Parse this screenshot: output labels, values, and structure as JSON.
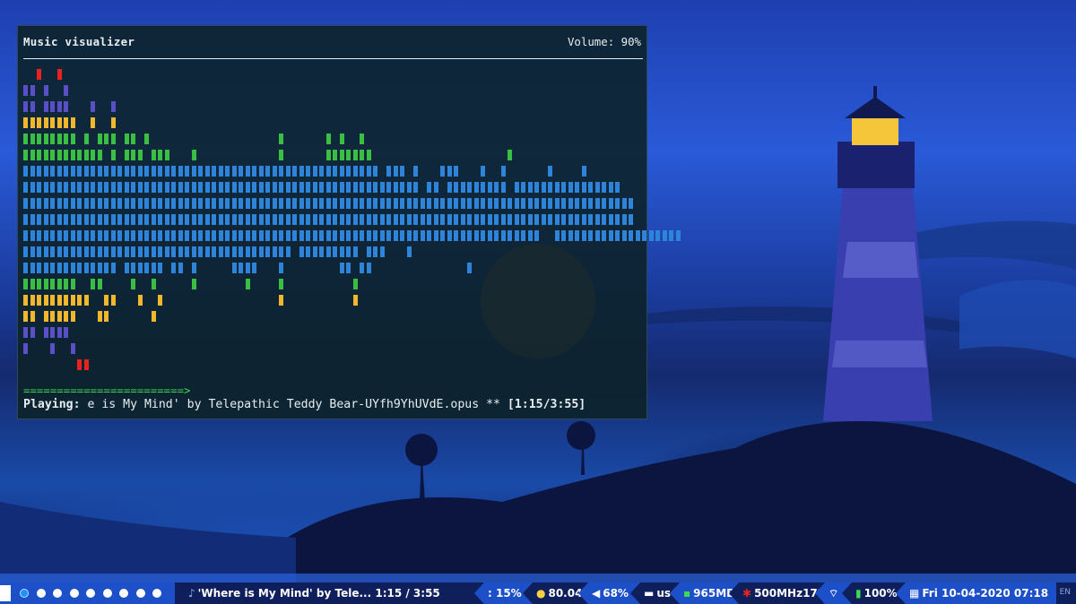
{
  "terminal": {
    "title": "Music visualizer",
    "volume": "Volume: 90%",
    "progress": "========================>",
    "playing_label": "Playing:",
    "playing_text": " e is My Mind' by Telepathic Teddy Bear-UYfh9YhUVdE.opus ** ",
    "time": "[1:15/3:55]"
  },
  "visualizer": {
    "colors": {
      "red": "#e8231d",
      "purple": "#5a4fc6",
      "yellow": "#f0b82a",
      "green": "#3bbf43",
      "blue": "#2d84d8"
    },
    "rows": [
      {
        "color": "red",
        "cells": "  *  *"
      },
      {
        "color": "purple",
        "cells": "** *  *"
      },
      {
        "color": "purple",
        "cells": "** ****   *  *"
      },
      {
        "color": "yellow",
        "cells": "********  *  *"
      },
      {
        "color": "green",
        "cells": "******** * *** ** *                   *      * *  *"
      },
      {
        "color": "green",
        "cells": "************ * *** ***   *            *      *******                    *"
      },
      {
        "color": "blue",
        "cells": "***************************************************** *** *   ***   *  *      *    *"
      },
      {
        "color": "blue",
        "cells": "*********************************************************** ** ********* ****************"
      },
      {
        "color": "blue",
        "cells": "*******************************************************************************************"
      },
      {
        "color": "blue",
        "cells": "*******************************************************************************************"
      },
      {
        "color": "blue",
        "cells": "*****************************************************************************  *******************"
      },
      {
        "color": "blue",
        "cells": "**************************************** ********* ***   *"
      },
      {
        "color": "blue",
        "cells": "************** ****** ** *     ****   *        ** **              *"
      },
      {
        "color": "green",
        "cells": "********  **    *  *     *       *    *          *"
      },
      {
        "color": "yellow",
        "cells": "**********  **   *  *                 *          *"
      },
      {
        "color": "yellow",
        "cells": "** *****   **      *"
      },
      {
        "color": "purple",
        "cells": "** ****"
      },
      {
        "color": "purple",
        "cells": "*   *  *"
      },
      {
        "color": "red",
        "cells": "        **"
      }
    ]
  },
  "taskbar": {
    "now_playing": "'Where is My Mind' by Tele... 1:15 / 3:55",
    "cpu": ": 15%",
    "temp": "80.04",
    "audio": "68%",
    "keyboard": "us",
    "memory": "965MB",
    "cpu_freq": "500MHz17%",
    "battery": "100%",
    "datetime": "Fri 10-04-2020 07:18",
    "lang": "EN",
    "workspace_count": 9,
    "active_workspace": 1
  }
}
